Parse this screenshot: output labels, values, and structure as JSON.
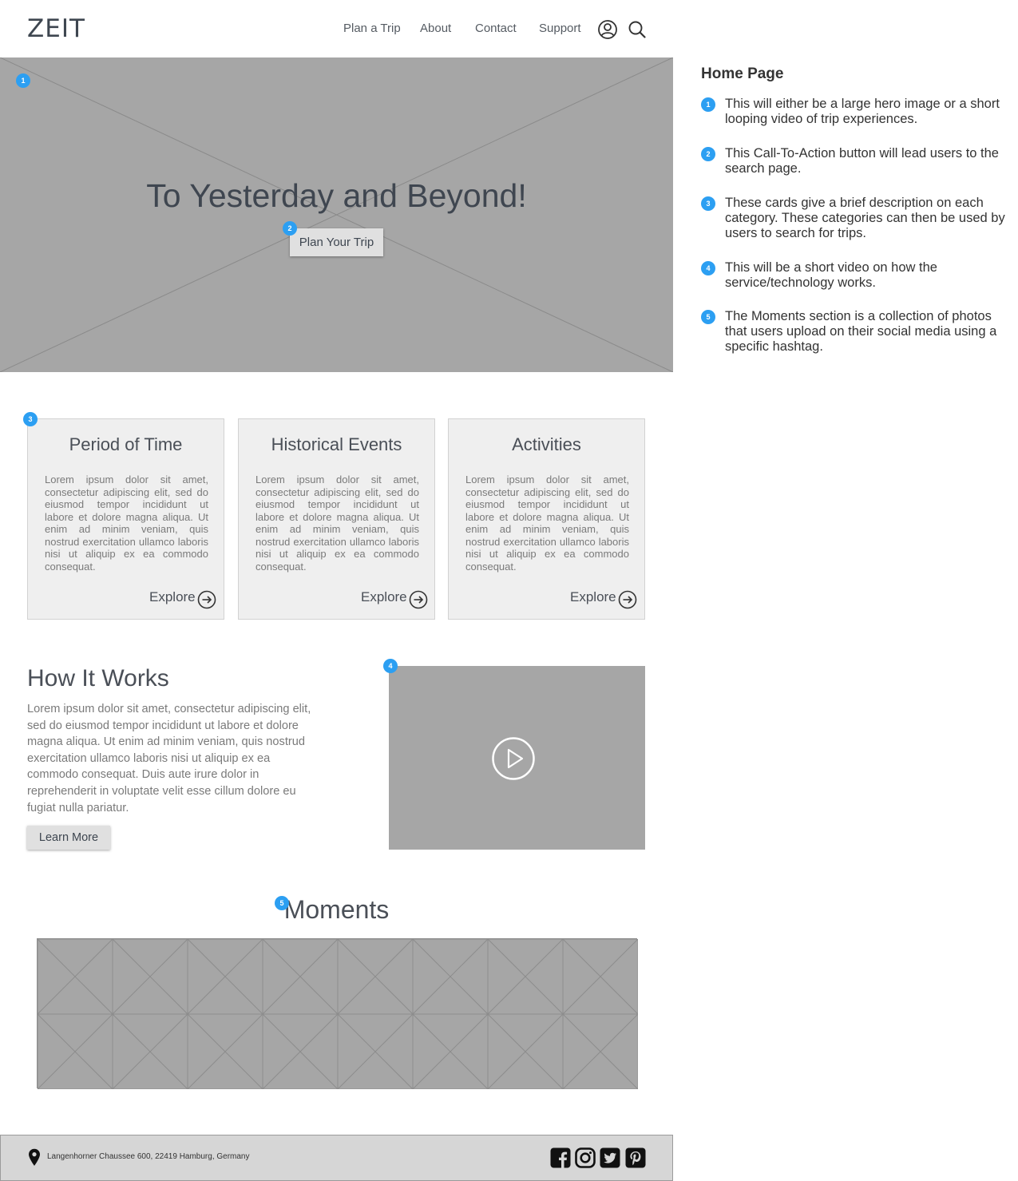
{
  "header": {
    "logo": "ZEIT",
    "nav": [
      "Plan a Trip",
      "About",
      "Contact",
      "Support"
    ],
    "icons": [
      "user-icon",
      "search-icon"
    ]
  },
  "hero": {
    "title": "To Yesterday and Beyond!",
    "cta_label": "Plan Your Trip"
  },
  "badges": [
    "1",
    "2",
    "3",
    "4",
    "5"
  ],
  "notes": {
    "title": "Home Page",
    "items": [
      {
        "num": "1",
        "text": "This will either be a large hero image or a short looping video of trip experiences."
      },
      {
        "num": "2",
        "text": "This Call-To-Action button will lead users to the search page."
      },
      {
        "num": "3",
        "text": "These cards give a brief description on each category. These categories can then be used by users to search for trips."
      },
      {
        "num": "4",
        "text": "This will be a short video on how the service/technology works."
      },
      {
        "num": "5",
        "text": "The Moments section is a collection of photos that users upload on their social media using a specific hashtag."
      }
    ]
  },
  "cards": [
    {
      "title": "Period of Time",
      "body": "Lorem ipsum dolor sit amet, consectetur adipiscing elit, sed do eiusmod tempor incididunt ut labore et dolore magna aliqua. Ut enim ad minim veniam, quis nostrud exercitation ullamco laboris nisi ut aliquip ex ea commodo consequat.",
      "link": "Explore"
    },
    {
      "title": "Historical Events",
      "body": "Lorem ipsum dolor sit amet, consectetur adipiscing elit, sed do eiusmod tempor incididunt ut labore et dolore magna aliqua. Ut enim ad minim veniam, quis nostrud exercitation ullamco laboris nisi ut aliquip ex ea commodo consequat.",
      "link": "Explore"
    },
    {
      "title": "Activities",
      "body": "Lorem ipsum dolor sit amet, consectetur adipiscing elit, sed do eiusmod tempor incididunt ut labore et dolore magna aliqua. Ut enim ad minim veniam, quis nostrud exercitation ullamco laboris nisi ut aliquip ex ea commodo consequat.",
      "link": "Explore"
    }
  ],
  "how_it_works": {
    "title": "How It Works",
    "body": "Lorem ipsum dolor sit amet, consectetur adipiscing elit, sed do eiusmod tempor incididunt ut labore et dolore magna aliqua. Ut enim ad minim veniam, quis nostrud exercitation ullamco laboris nisi ut aliquip ex ea commodo consequat. Duis aute irure dolor in reprehenderit in voluptate velit esse cillum dolore eu fugiat nulla pariatur.",
    "button": "Learn More",
    "video_icon": "play-icon"
  },
  "moments": {
    "title": "Moments"
  },
  "footer": {
    "address": "Langenhorner Chaussee 600, 22419 Hamburg, Germany",
    "location_icon": "location-pin-icon",
    "social": [
      "facebook-icon",
      "instagram-icon",
      "twitter-icon",
      "pinterest-icon"
    ]
  },
  "colors": {
    "badge": "#2c9ff2",
    "placeholder": "#a6a6a6",
    "card_bg": "#efefef",
    "footer_bg": "#d6d6d6"
  }
}
